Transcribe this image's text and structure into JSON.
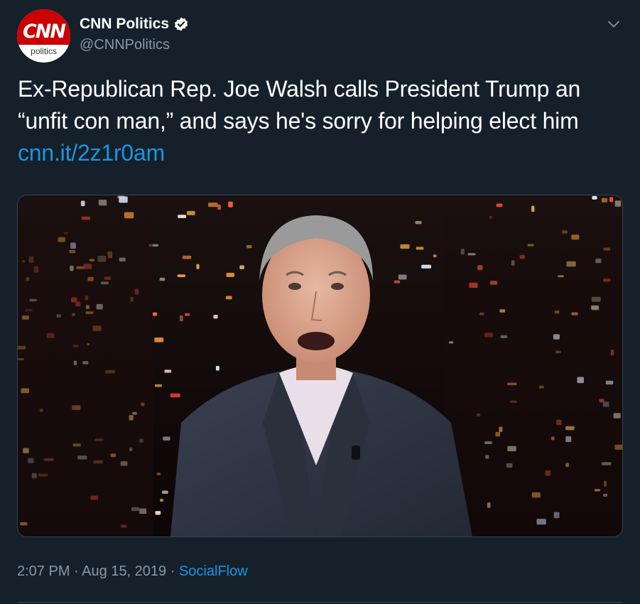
{
  "author": {
    "name": "CNN Politics",
    "handle": "@CNNPolitics",
    "avatar_logo": "CNN",
    "avatar_sub": "politics",
    "verified_icon": "verified-badge-icon"
  },
  "tweet": {
    "text": "Ex-Republican Rep. Joe Walsh calls President Trump an “unfit con man,” and says he's sorry for helping elect him ",
    "link": "cnn.it/2z1r0am"
  },
  "meta": {
    "time": "2:07 PM",
    "separator": "·",
    "date": "Aug 15, 2019",
    "source": "SocialFlow"
  },
  "colors": {
    "background": "#15202b",
    "link": "#1b95e0",
    "secondary_text": "#8899a6",
    "border": "#38444d",
    "brand_red": "#cc0000"
  }
}
